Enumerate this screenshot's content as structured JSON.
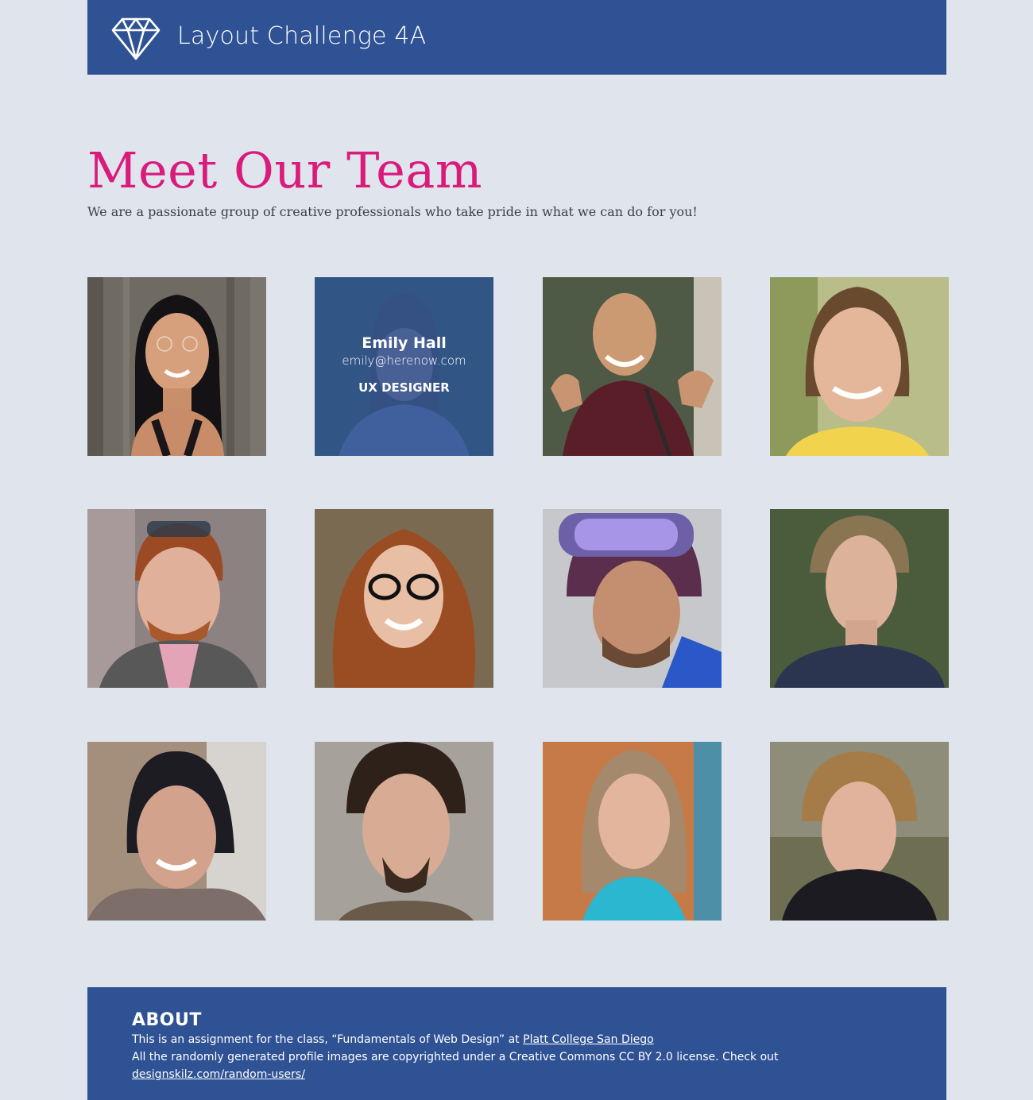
{
  "header": {
    "title": "Layout Challenge 4A",
    "logo_icon": "diamond-icon"
  },
  "hero": {
    "title": "Meet Our Team",
    "subtitle": "We are a passionate group of creative professionals who take pride in what we can do for you!"
  },
  "team": {
    "hovered_member": {
      "name": "Emily Hall",
      "email": "emily@herenow.com",
      "role": "UX DESIGNER"
    }
  },
  "footer": {
    "heading": "ABOUT",
    "line1_text": "This is an assignment for the class, “Fundamentals of Web Design” at",
    "line1_link": "Platt College San Diego",
    "line2_text": "All the randomly generated profile images are copyrighted under a Creative Commons CC BY 2.0 license. Check out",
    "line3_link": "designskilz.com/random-users/"
  },
  "colors": {
    "brand_blue": "#2f5294",
    "accent_pink": "#d91b7b",
    "background": "#e0e4ed"
  }
}
